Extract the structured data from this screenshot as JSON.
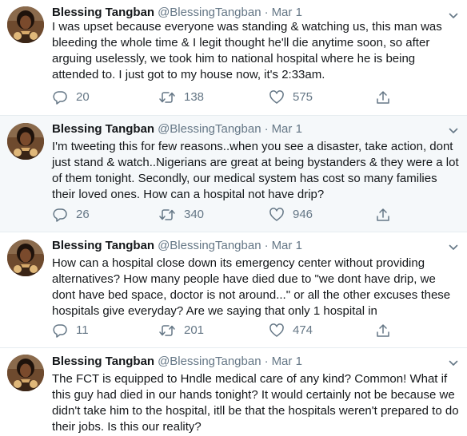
{
  "tweets": [
    {
      "author_name": "Blessing Tangban",
      "handle": "@BlessingTangban",
      "separator": "·",
      "date": "Mar 1",
      "text": "I was upset because everyone was standing & watching us, this man was bleeding the whole time & I legit thought he'll die anytime soon, so after arguing uselessly, we took him to national hospital where he is being attended to. I just got to my house now, it's 2:33am.",
      "replies": "20",
      "retweets": "138",
      "likes": "575"
    },
    {
      "author_name": "Blessing Tangban",
      "handle": "@BlessingTangban",
      "separator": "·",
      "date": "Mar 1",
      "text": "I'm tweeting this for few reasons..when you see a disaster, take action, dont just stand & watch..Nigerians are great at being bystanders & they were a lot of them tonight. Secondly, our medical system has cost so many families their loved ones. How can a hospital not have drip?",
      "replies": "26",
      "retweets": "340",
      "likes": "946"
    },
    {
      "author_name": "Blessing Tangban",
      "handle": "@BlessingTangban",
      "separator": "·",
      "date": "Mar 1",
      "text": "How can a hospital close down its emergency center without providing alternatives? How many people have died due to \"we dont have drip, we dont have bed space, doctor is not around...\" or all the other excuses these hospitals give everyday? Are we saying that only 1 hospital in",
      "replies": "11",
      "retweets": "201",
      "likes": "474"
    },
    {
      "author_name": "Blessing Tangban",
      "handle": "@BlessingTangban",
      "separator": "·",
      "date": "Mar 1",
      "text": "The FCT is equipped to Hndle medical care of any kind? Common! What if this guy had died in our hands tonight? It would certainly not be because we didn't take him to the hospital, itll be that the hospitals weren't prepared to do their jobs. Is this our reality?"
    }
  ],
  "icons": {
    "reply": "reply-icon",
    "retweet": "retweet-icon",
    "like": "heart-icon",
    "share": "share-icon",
    "more": "chevron-down-icon"
  },
  "colors": {
    "text": "#14171a",
    "muted": "#657786",
    "thread_line": "#ccd6dd",
    "highlight_bg": "#f5f8fa",
    "divider": "#e6ecf0"
  }
}
